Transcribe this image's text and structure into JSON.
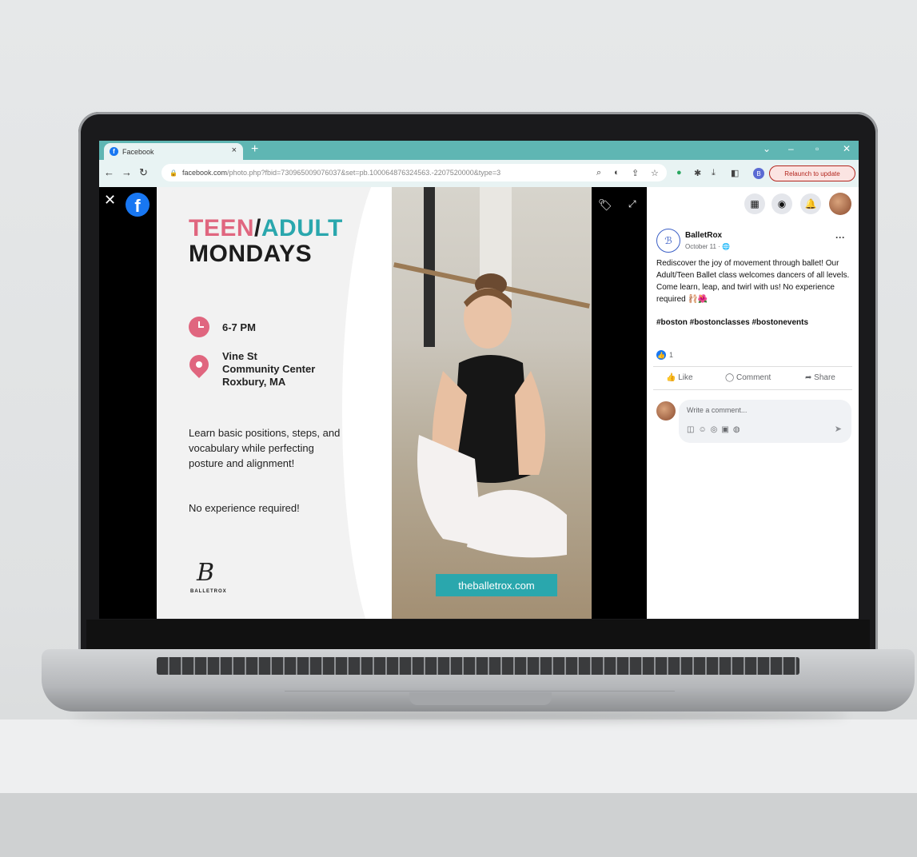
{
  "browser": {
    "tab_title": "Facebook",
    "tab_close": "×",
    "new_tab": "+",
    "url_host": "facebook.com",
    "url_path": "/photo.php?fbid=730965009076037&set=pb.100064876324563.-2207520000&type=3",
    "profile_initial": "B",
    "relaunch_label": "Relaunch to update"
  },
  "viewer": {
    "close": "✕",
    "fb_logo": "f"
  },
  "poster": {
    "title_teen": "TEEN",
    "title_slash": "/",
    "title_adult": "ADULT",
    "title_day": "MONDAYS",
    "time": "6-7 PM",
    "venue_line1": "Vine St",
    "venue_line2": "Community Center",
    "venue_line3": "Roxbury, MA",
    "description": "Learn basic positions, steps, and vocabulary while perfecting posture and alignment!",
    "experience": "No experience required!",
    "logo_mark": "B",
    "logo_name": "BALLETROX",
    "website": "theballetrox.com"
  },
  "post": {
    "page_name": "BalletRox",
    "date": "October 11 · ",
    "text": "Rediscover the joy of movement through ballet! Our Adult/Teen Ballet class welcomes dancers of all levels. Come learn, leap, and twirl with us! No experience required 🩰🌺",
    "hashtags": "#boston #bostonclasses #bostonevents",
    "like_count": "1",
    "like_label": "Like",
    "comment_label": "Comment",
    "share_label": "Share",
    "comment_placeholder": "Write a comment...",
    "more": "···"
  },
  "colors": {
    "accent_pink": "#e0667f",
    "accent_teal": "#2aa7ad",
    "facebook_blue": "#1877f2",
    "tabbar": "#5fb6b3"
  },
  "icons": [
    "facebook-favicon",
    "back-arrow-icon",
    "forward-arrow-icon",
    "reload-icon",
    "lock-icon",
    "search-icon",
    "star-icon",
    "extensions-icon",
    "download-icon",
    "menu-grid-icon",
    "messenger-icon",
    "bell-icon",
    "tag-icon",
    "expand-icon",
    "clock-icon",
    "location-pin-icon",
    "send-icon"
  ]
}
